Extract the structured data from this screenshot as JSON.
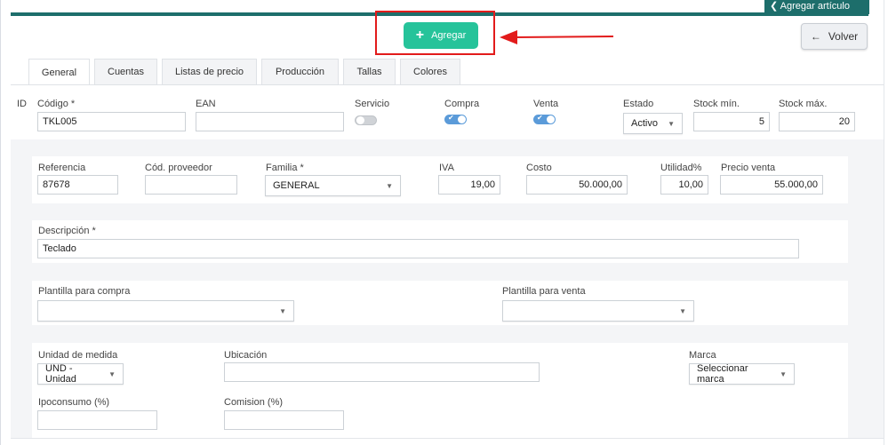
{
  "header": {
    "badge_label": "Agregar artículo"
  },
  "actions": {
    "add_label": "Agregar",
    "back_label": "Volver"
  },
  "tabs": [
    {
      "label": "General"
    },
    {
      "label": "Cuentas"
    },
    {
      "label": "Listas de precio"
    },
    {
      "label": "Producción"
    },
    {
      "label": "Tallas"
    },
    {
      "label": "Colores"
    }
  ],
  "row1": {
    "id_label": "ID",
    "codigo_label": "Código *",
    "codigo_value": "TKL005",
    "ean_label": "EAN",
    "ean_value": "",
    "servicio_label": "Servicio",
    "compra_label": "Compra",
    "venta_label": "Venta",
    "estado_label": "Estado",
    "estado_value": "Activo",
    "stock_min_label": "Stock mín.",
    "stock_min_value": "5",
    "stock_max_label": "Stock máx.",
    "stock_max_value": "20"
  },
  "row2": {
    "referencia_label": "Referencia",
    "referencia_value": "87678",
    "cod_proveedor_label": "Cód. proveedor",
    "cod_proveedor_value": "",
    "familia_label": "Familia *",
    "familia_value": "GENERAL",
    "iva_label": "IVA",
    "iva_value": "19,00",
    "costo_label": "Costo",
    "costo_value": "50.000,00",
    "utilidad_label": "Utilidad%",
    "utilidad_value": "10,00",
    "precio_venta_label": "Precio venta",
    "precio_venta_value": "55.000,00"
  },
  "descripcion": {
    "label": "Descripción *",
    "value": "Teclado"
  },
  "plantillas": {
    "compra_label": "Plantilla para compra",
    "compra_value": "",
    "venta_label": "Plantilla para venta",
    "venta_value": ""
  },
  "row5": {
    "unidad_label": "Unidad de medida",
    "unidad_value": "UND - Unidad",
    "ubicacion_label": "Ubicación",
    "ubicacion_value": "",
    "marca_label": "Marca",
    "marca_value": "Seleccionar marca",
    "ipoconsumo_label": "Ipoconsumo (%)",
    "ipoconsumo_value": "",
    "comision_label": "Comision (%)",
    "comision_value": ""
  },
  "toggles": {
    "servicio": false,
    "compra": true,
    "venta": true
  },
  "colors": {
    "accent": "#26c39a",
    "header_bar": "#1d6e6b",
    "highlight": "#e21b1b",
    "toggle_on": "#5b9bd9"
  }
}
